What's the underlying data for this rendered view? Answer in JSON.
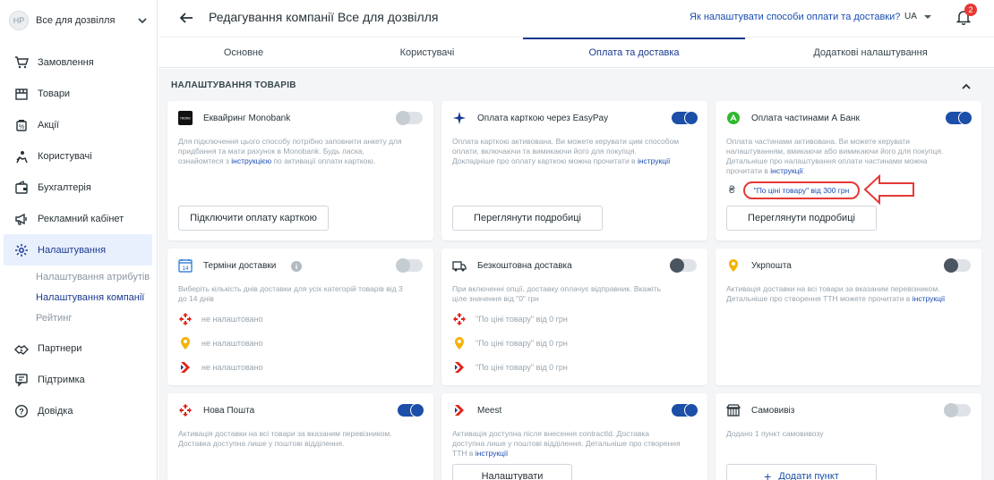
{
  "store": {
    "initials": "HP",
    "name": "Все для дозвілля"
  },
  "nav": [
    {
      "label": "Замовлення",
      "icon": "cart-icon"
    },
    {
      "label": "Товари",
      "icon": "box-icon"
    },
    {
      "label": "Акції",
      "icon": "discount-icon"
    },
    {
      "label": "Користувачі",
      "icon": "users-icon"
    },
    {
      "label": "Бухгалтерія",
      "icon": "wallet-icon"
    },
    {
      "label": "Рекламний кабінет",
      "icon": "megaphone-icon"
    },
    {
      "label": "Налаштування",
      "icon": "gear-icon"
    },
    {
      "label": "Партнери",
      "icon": "handshake-icon"
    },
    {
      "label": "Підтримка",
      "icon": "chat-icon"
    },
    {
      "label": "Дoвідка",
      "icon": "help-icon"
    }
  ],
  "subnav": [
    "Налаштування атрибутів",
    "Налаштування компанії",
    "Рейтинг"
  ],
  "header": {
    "title": "Редагування компанії Все для дозвілля",
    "help_link": "Як налаштувати способи оплати та доставки?",
    "lang": "UA",
    "notifications": "2"
  },
  "tabs": [
    "Основне",
    "Користувачі",
    "Оплата та доставка",
    "Додаткові налаштування"
  ],
  "section_title": "НАЛАШТУВАННЯ ТОВАРІВ",
  "cards": {
    "monobank": {
      "title": "Еквайринг Monobank",
      "logo": "mono",
      "desc1": "Для підключення цього способу потрібно заповнити анкету для",
      "desc2": "придбання та мати рахунок в Monobank. Будь ласка,",
      "desc3a": "ознайомтеся з ",
      "desc3link": "інструкцією",
      "desc3b": " по активації оплати карткою.",
      "button": "Підключити оплату карткою",
      "enabled": false
    },
    "easypay": {
      "title": "Оплата карткою через EasyPay",
      "desc1": "Оплата карткою активована. Ви можете керувати цим способом",
      "desc2": "оплати, включаючи та вимикаючи його для покупця.",
      "desc3a": "Докладніше про оплату карткою можна прочитати в ",
      "desc3link": "інструкції",
      "button": "Переглянути подробиці",
      "enabled": true
    },
    "abank": {
      "title": "Оплата частинами А Банк",
      "desc1": "Оплата частинами активована. Ви можете керувати",
      "desc2": "налаштуванням, вмикаючи або вимикаючи його для покупця.",
      "desc3": "Детальніше про налаштування оплати частинами можна",
      "desc4a": "прочитати в ",
      "desc4link": "інструкції",
      "desc4b": ".",
      "price_rule": "\"По ціні товару\" від 300 грн",
      "currency": "₴",
      "button": "Переглянути подробиці",
      "enabled": true
    },
    "delivery_terms": {
      "title": "Терміни доставки",
      "desc1": "Виберіть кількість днів доставки для усіх категорій товарів від 3",
      "desc2": "до 14 днів",
      "rows": [
        "не налаштовано",
        "не налаштовано",
        "не налаштовано"
      ],
      "enabled": false
    },
    "free_delivery": {
      "title": "Безкоштовна доставка",
      "desc1": "При включенні опції, доставку оплачує відправник. Вкажіть",
      "desc2": "ціле значення від \"0\" грн",
      "rows": [
        "\"По ціні товару\" від 0 грн",
        "\"По ціні товару\" від 0 грн",
        "\"По ціні товару\" від 0 грн"
      ],
      "enabled": false
    },
    "ukrposhta": {
      "title": "Укрпошта",
      "desc1": "Активація доставки на всі товари за вказаним перевізником.",
      "desc2a": "Детальніше про створення ТТН можете прочитати в ",
      "desc2link": "інструкції",
      "enabled": false
    },
    "novaposhta": {
      "title": "Нова Пошта",
      "desc1": "Активація доставки на всі товари за вказаним перевізником.",
      "desc2": "Доставка доступна лише у поштові відділення.",
      "enabled": true
    },
    "meest": {
      "title": "Meest",
      "desc1": "Активація доступна після внесення contractId. Доставка",
      "desc2": "доступна лише у поштові відділення. Детальніше про створення",
      "desc3a": "ТТН в ",
      "desc3link": "інструкції",
      "button": "Налаштувати",
      "enabled": true
    },
    "pickup": {
      "title": "Самовивіз",
      "desc1": "Додано 1 пункт самовивозу",
      "button": "Додати пункт",
      "enabled": false
    }
  },
  "colors": {
    "accent": "#1b4fa8",
    "link": "#1a4db3",
    "highlight": "#e53935",
    "nova": "#e2231a",
    "meest": "#e2231a",
    "ukrposhta": "#f5b301"
  }
}
